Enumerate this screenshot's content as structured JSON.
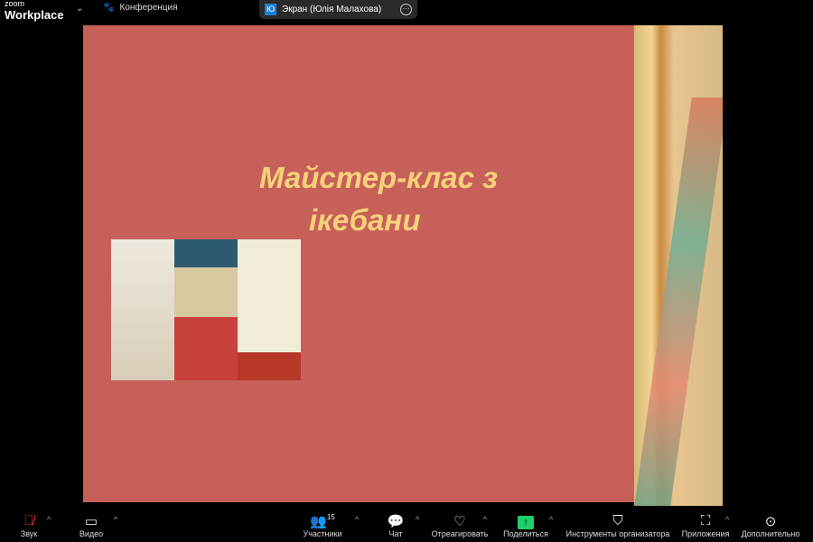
{
  "app": {
    "logo_small": "zoom",
    "logo_big": "Workplace",
    "meeting_label": "Конференция"
  },
  "share_banner": {
    "avatar": "Ю",
    "label": "Экран (Юлія Малахова)"
  },
  "slide": {
    "title_line1": "Майстер-клас з",
    "title_line2": "ікебани"
  },
  "toolbar": {
    "audio": "Звук",
    "video": "Видео",
    "participants": "Участники",
    "participants_count": "15",
    "chat": "Чат",
    "react": "Отреагировать",
    "share": "Поделиться",
    "host_tools": "Инструменты организатора",
    "apps": "Приложения",
    "more": "Дополнительно"
  },
  "colors": {
    "slide_bg": "#c8605a",
    "title": "#f6d27a",
    "share_accent": "#1fd06a"
  }
}
